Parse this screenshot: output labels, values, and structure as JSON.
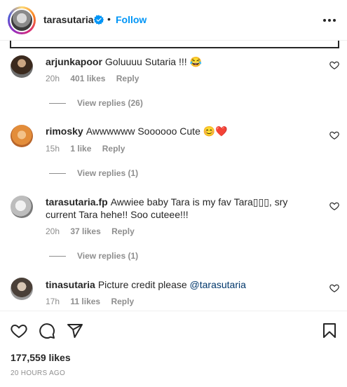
{
  "header": {
    "username": "tarasutaria",
    "separator": "•",
    "follow_label": "Follow",
    "verified_icon": "verified-badge-icon",
    "more_icon": "more-options-icon"
  },
  "comments": [
    {
      "username": "arjunkapoor",
      "text": "Goluuuu Sutaria !!! 😂",
      "time": "20h",
      "likes": "401 likes",
      "reply_label": "Reply",
      "view_replies": "View replies (26)"
    },
    {
      "username": "rimosky",
      "text": "Awwwwww Soooooo Cute 😊❤️",
      "time": "15h",
      "likes": "1 like",
      "reply_label": "Reply",
      "view_replies": "View replies (1)"
    },
    {
      "username": "tarasutaria.fp",
      "text": "Awwiee baby Tara is my fav Tara▯▯▯, sry current Tara hehe!! Soo cuteee!!!",
      "time": "20h",
      "likes": "37 likes",
      "reply_label": "Reply",
      "view_replies": "View replies (1)"
    },
    {
      "username": "tinasutaria",
      "text": "Picture credit please ",
      "mention": "@tarasutaria",
      "time": "17h",
      "likes": "11 likes",
      "reply_label": "Reply"
    }
  ],
  "footer": {
    "likes": "177,559 likes",
    "time_ago": "20 HOURS AGO"
  },
  "colors": {
    "accent": "#0095f6",
    "text": "#262626",
    "muted": "#8e8e8e",
    "mention": "#00376b"
  }
}
